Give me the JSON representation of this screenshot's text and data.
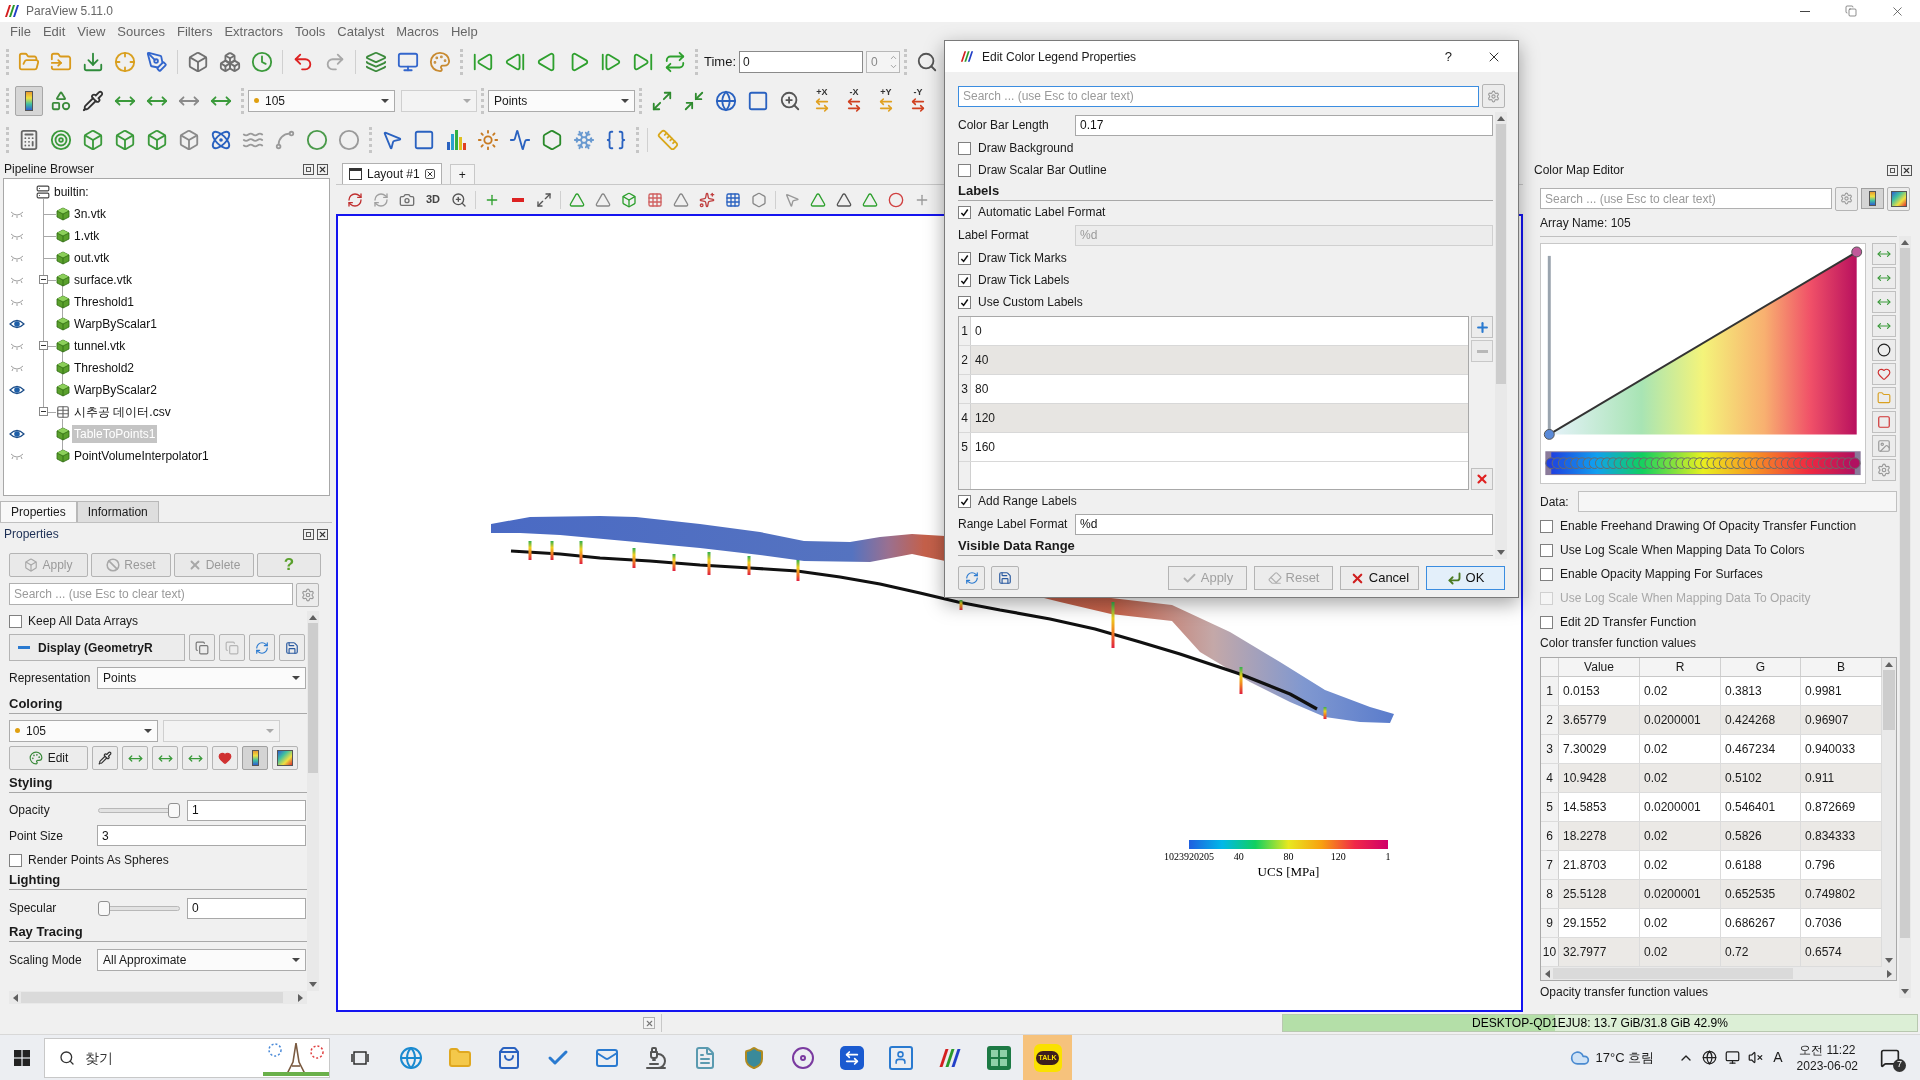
{
  "window": {
    "title": "ParaView 5.11.0"
  },
  "menu": [
    "File",
    "Edit",
    "View",
    "Sources",
    "Filters",
    "Extractors",
    "Tools",
    "Catalyst",
    "Macros",
    "Help"
  ],
  "toolbar": {
    "time_label": "Time:",
    "time_value": "0",
    "time_index": "0",
    "array": "105",
    "representation": "Points",
    "camera_axes": [
      "+X",
      "-X",
      "+Y",
      "-Y"
    ]
  },
  "pipeline_browser": {
    "title": "Pipeline Browser",
    "items": [
      {
        "label": "builtin:",
        "kind": "server",
        "selected": false,
        "children": [
          {
            "label": "3n.vtk",
            "kind": "data",
            "visible": false,
            "selected": false
          },
          {
            "label": "1.vtk",
            "kind": "data",
            "visible": false,
            "selected": false
          },
          {
            "label": "out.vtk",
            "kind": "data",
            "visible": false,
            "selected": false
          },
          {
            "label": "surface.vtk",
            "kind": "data",
            "visible": false,
            "selected": false,
            "expanded": true,
            "children": [
              {
                "label": "Threshold1",
                "kind": "data",
                "visible": false,
                "selected": false
              },
              {
                "label": "WarpByScalar1",
                "kind": "data",
                "visible": true,
                "selected": false
              }
            ]
          },
          {
            "label": "tunnel.vtk",
            "kind": "data",
            "visible": false,
            "selected": false,
            "expanded": true,
            "children": [
              {
                "label": "Threshold2",
                "kind": "data",
                "visible": false,
                "selected": false
              },
              {
                "label": "WarpByScalar2",
                "kind": "data",
                "visible": true,
                "selected": false
              }
            ]
          },
          {
            "label": "시추공 데이터.csv",
            "kind": "table",
            "selected": false,
            "expanded": true,
            "children": [
              {
                "label": "TableToPoints1",
                "kind": "data",
                "visible": true,
                "selected": true
              },
              {
                "label": "PointVolumeInterpolator1",
                "kind": "data",
                "visible": false,
                "selected": false
              }
            ]
          }
        ]
      }
    ]
  },
  "properties_panel": {
    "tabs": [
      {
        "label": "Properties",
        "selected": true
      },
      {
        "label": "Information",
        "selected": false
      }
    ],
    "title": "Properties",
    "buttons": [
      {
        "kind": "apply",
        "label": "Apply",
        "disabled": true
      },
      {
        "kind": "reset",
        "label": "Reset",
        "disabled": true
      },
      {
        "kind": "delete",
        "label": "Delete",
        "disabled": true
      },
      {
        "kind": "help",
        "label": "?",
        "disabled": false
      }
    ],
    "search": {
      "placeholder": "Search ... (use Esc to clear text)"
    },
    "keep_arrays": {
      "label": "Keep All Data Arrays",
      "checked": false
    },
    "display": {
      "label": "Display (GeometryR"
    },
    "representation": {
      "label": "Representation",
      "value": "Points"
    },
    "coloring": {
      "title": "Coloring",
      "array": "105",
      "edit_label": "Edit"
    },
    "styling": {
      "title": "Styling",
      "opacity": {
        "label": "Opacity",
        "level": 1,
        "value": "1"
      },
      "point_size": {
        "label": "Point Size",
        "value": "3"
      },
      "spheres": {
        "label": "Render Points As Spheres",
        "checked": false
      }
    },
    "lighting": {
      "title": "Lighting",
      "specular": {
        "label": "Specular",
        "level": 0,
        "value": "0"
      }
    },
    "ray_tracing": {
      "title": "Ray Tracing",
      "scaling_mode": {
        "label": "Scaling Mode",
        "value": "All Approximate"
      }
    }
  },
  "view": {
    "tabs": [
      {
        "label": "Layout #1",
        "selected": true
      }
    ],
    "new_tab_label": "+",
    "mode_label": "3D",
    "legend": {
      "title": "UCS [MPa]",
      "labels": [
        "1023920205",
        "40",
        "80",
        "120",
        "1"
      ]
    }
  },
  "dialog": {
    "title": "Edit Color Legend Properties",
    "help_label": "?",
    "search": {
      "placeholder": "Search ... (use Esc to clear text)"
    },
    "rows": [
      {
        "kind": "field",
        "label": "Color Bar Length",
        "value": "0.17",
        "disabled": false
      },
      {
        "kind": "checkbox",
        "label": "Draw Background",
        "checked": false
      },
      {
        "kind": "checkbox",
        "label": "Draw Scalar Bar Outline",
        "checked": false
      },
      {
        "kind": "section",
        "label": "Labels"
      },
      {
        "kind": "checkbox",
        "label": "Automatic Label Format",
        "checked": true
      },
      {
        "kind": "field",
        "label": "Label Format",
        "value": "%d",
        "disabled": true
      },
      {
        "kind": "checkbox",
        "label": "Draw Tick Marks",
        "checked": true
      },
      {
        "kind": "checkbox",
        "label": "Draw Tick Labels",
        "checked": true
      },
      {
        "kind": "checkbox",
        "label": "Use Custom Labels",
        "checked": true
      },
      {
        "kind": "list",
        "items": [
          {
            "index": "1",
            "value": "0"
          },
          {
            "index": "2",
            "value": "40"
          },
          {
            "index": "3",
            "value": "80"
          },
          {
            "index": "4",
            "value": "120"
          },
          {
            "index": "5",
            "value": "160"
          }
        ],
        "remove_disabled": true
      },
      {
        "kind": "checkbox",
        "label": "Add Range Labels",
        "checked": true
      },
      {
        "kind": "field",
        "label": "Range Label Format",
        "value": "%d",
        "disabled": false
      },
      {
        "kind": "section",
        "label": "Visible Data Range"
      }
    ],
    "buttons": [
      {
        "kind": "apply",
        "label": "Apply",
        "disabled": true
      },
      {
        "kind": "reset",
        "label": "Reset",
        "disabled": true
      },
      {
        "kind": "cancel",
        "label": "Cancel",
        "disabled": false
      },
      {
        "kind": "ok",
        "label": "OK",
        "disabled": false
      }
    ]
  },
  "color_map_editor": {
    "title": "Color Map Editor",
    "search": {
      "placeholder": "Search ... (use Esc to clear text)"
    },
    "array_name": "Array Name: 105",
    "data_label": "Data:",
    "options": [
      {
        "label": "Enable Freehand Drawing Of Opacity Transfer Function",
        "checked": false,
        "disabled": false
      },
      {
        "label": "Use Log Scale When Mapping Data To Colors",
        "checked": false,
        "disabled": false
      },
      {
        "label": "Enable Opacity Mapping For Surfaces",
        "checked": false,
        "disabled": false
      },
      {
        "label": "Use Log Scale When Mapping Data To Opacity",
        "checked": false,
        "disabled": true
      },
      {
        "label": "Edit 2D Transfer Function",
        "checked": false,
        "disabled": false
      }
    ],
    "table_title": "Color transfer function values",
    "columns": [
      "Value",
      "R",
      "G",
      "B"
    ],
    "rows": [
      {
        "index": "1",
        "cells": [
          "0.0153",
          "0.02",
          "0.3813",
          "0.9981"
        ]
      },
      {
        "index": "2",
        "cells": [
          "3.65779",
          "0.0200001",
          "0.424268",
          "0.96907"
        ]
      },
      {
        "index": "3",
        "cells": [
          "7.30029",
          "0.02",
          "0.467234",
          "0.940033"
        ]
      },
      {
        "index": "4",
        "cells": [
          "10.9428",
          "0.02",
          "0.5102",
          "0.911"
        ]
      },
      {
        "index": "5",
        "cells": [
          "14.5853",
          "0.0200001",
          "0.546401",
          "0.872669"
        ]
      },
      {
        "index": "6",
        "cells": [
          "18.2278",
          "0.02",
          "0.5826",
          "0.834333"
        ]
      },
      {
        "index": "7",
        "cells": [
          "21.8703",
          "0.02",
          "0.6188",
          "0.796"
        ]
      },
      {
        "index": "8",
        "cells": [
          "25.5128",
          "0.0200001",
          "0.652535",
          "0.749802"
        ]
      },
      {
        "index": "9",
        "cells": [
          "29.1552",
          "0.02",
          "0.686267",
          "0.7036"
        ]
      },
      {
        "index": "10",
        "cells": [
          "32.7977",
          "0.02",
          "0.72",
          "0.6574"
        ]
      }
    ],
    "next_title": "Opacity transfer function values"
  },
  "status_bar": {
    "memory": {
      "label": "DESKTOP-QD1EJU8: 13.7 GiB/31.8 GiB 42.9%",
      "level": 0.429
    }
  },
  "taskbar": {
    "search_placeholder": "찾기",
    "chat_logo": "TALK",
    "weather": "17°C 흐림",
    "input_mode": "A",
    "time": "오전 11:22",
    "date": "2023-06-02",
    "notifications": "7"
  }
}
